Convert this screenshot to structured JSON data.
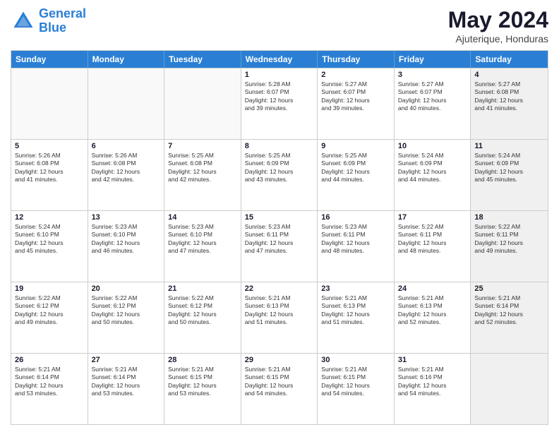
{
  "logo": {
    "line1": "General",
    "line2": "Blue"
  },
  "title": "May 2024",
  "subtitle": "Ajuterique, Honduras",
  "headers": [
    "Sunday",
    "Monday",
    "Tuesday",
    "Wednesday",
    "Thursday",
    "Friday",
    "Saturday"
  ],
  "rows": [
    [
      {
        "day": "",
        "info": "",
        "empty": true
      },
      {
        "day": "",
        "info": "",
        "empty": true
      },
      {
        "day": "",
        "info": "",
        "empty": true
      },
      {
        "day": "1",
        "info": "Sunrise: 5:28 AM\nSunset: 6:07 PM\nDaylight: 12 hours\nand 39 minutes.",
        "empty": false
      },
      {
        "day": "2",
        "info": "Sunrise: 5:27 AM\nSunset: 6:07 PM\nDaylight: 12 hours\nand 39 minutes.",
        "empty": false
      },
      {
        "day": "3",
        "info": "Sunrise: 5:27 AM\nSunset: 6:07 PM\nDaylight: 12 hours\nand 40 minutes.",
        "empty": false
      },
      {
        "day": "4",
        "info": "Sunrise: 5:27 AM\nSunset: 6:08 PM\nDaylight: 12 hours\nand 41 minutes.",
        "empty": false,
        "shaded": true
      }
    ],
    [
      {
        "day": "5",
        "info": "Sunrise: 5:26 AM\nSunset: 6:08 PM\nDaylight: 12 hours\nand 41 minutes.",
        "empty": false
      },
      {
        "day": "6",
        "info": "Sunrise: 5:26 AM\nSunset: 6:08 PM\nDaylight: 12 hours\nand 42 minutes.",
        "empty": false
      },
      {
        "day": "7",
        "info": "Sunrise: 5:25 AM\nSunset: 6:08 PM\nDaylight: 12 hours\nand 42 minutes.",
        "empty": false
      },
      {
        "day": "8",
        "info": "Sunrise: 5:25 AM\nSunset: 6:09 PM\nDaylight: 12 hours\nand 43 minutes.",
        "empty": false
      },
      {
        "day": "9",
        "info": "Sunrise: 5:25 AM\nSunset: 6:09 PM\nDaylight: 12 hours\nand 44 minutes.",
        "empty": false
      },
      {
        "day": "10",
        "info": "Sunrise: 5:24 AM\nSunset: 6:09 PM\nDaylight: 12 hours\nand 44 minutes.",
        "empty": false
      },
      {
        "day": "11",
        "info": "Sunrise: 5:24 AM\nSunset: 6:09 PM\nDaylight: 12 hours\nand 45 minutes.",
        "empty": false,
        "shaded": true
      }
    ],
    [
      {
        "day": "12",
        "info": "Sunrise: 5:24 AM\nSunset: 6:10 PM\nDaylight: 12 hours\nand 45 minutes.",
        "empty": false
      },
      {
        "day": "13",
        "info": "Sunrise: 5:23 AM\nSunset: 6:10 PM\nDaylight: 12 hours\nand 46 minutes.",
        "empty": false
      },
      {
        "day": "14",
        "info": "Sunrise: 5:23 AM\nSunset: 6:10 PM\nDaylight: 12 hours\nand 47 minutes.",
        "empty": false
      },
      {
        "day": "15",
        "info": "Sunrise: 5:23 AM\nSunset: 6:11 PM\nDaylight: 12 hours\nand 47 minutes.",
        "empty": false
      },
      {
        "day": "16",
        "info": "Sunrise: 5:23 AM\nSunset: 6:11 PM\nDaylight: 12 hours\nand 48 minutes.",
        "empty": false
      },
      {
        "day": "17",
        "info": "Sunrise: 5:22 AM\nSunset: 6:11 PM\nDaylight: 12 hours\nand 48 minutes.",
        "empty": false
      },
      {
        "day": "18",
        "info": "Sunrise: 5:22 AM\nSunset: 6:11 PM\nDaylight: 12 hours\nand 49 minutes.",
        "empty": false,
        "shaded": true
      }
    ],
    [
      {
        "day": "19",
        "info": "Sunrise: 5:22 AM\nSunset: 6:12 PM\nDaylight: 12 hours\nand 49 minutes.",
        "empty": false
      },
      {
        "day": "20",
        "info": "Sunrise: 5:22 AM\nSunset: 6:12 PM\nDaylight: 12 hours\nand 50 minutes.",
        "empty": false
      },
      {
        "day": "21",
        "info": "Sunrise: 5:22 AM\nSunset: 6:12 PM\nDaylight: 12 hours\nand 50 minutes.",
        "empty": false
      },
      {
        "day": "22",
        "info": "Sunrise: 5:21 AM\nSunset: 6:13 PM\nDaylight: 12 hours\nand 51 minutes.",
        "empty": false
      },
      {
        "day": "23",
        "info": "Sunrise: 5:21 AM\nSunset: 6:13 PM\nDaylight: 12 hours\nand 51 minutes.",
        "empty": false
      },
      {
        "day": "24",
        "info": "Sunrise: 5:21 AM\nSunset: 6:13 PM\nDaylight: 12 hours\nand 52 minutes.",
        "empty": false
      },
      {
        "day": "25",
        "info": "Sunrise: 5:21 AM\nSunset: 6:14 PM\nDaylight: 12 hours\nand 52 minutes.",
        "empty": false,
        "shaded": true
      }
    ],
    [
      {
        "day": "26",
        "info": "Sunrise: 5:21 AM\nSunset: 6:14 PM\nDaylight: 12 hours\nand 53 minutes.",
        "empty": false
      },
      {
        "day": "27",
        "info": "Sunrise: 5:21 AM\nSunset: 6:14 PM\nDaylight: 12 hours\nand 53 minutes.",
        "empty": false
      },
      {
        "day": "28",
        "info": "Sunrise: 5:21 AM\nSunset: 6:15 PM\nDaylight: 12 hours\nand 53 minutes.",
        "empty": false
      },
      {
        "day": "29",
        "info": "Sunrise: 5:21 AM\nSunset: 6:15 PM\nDaylight: 12 hours\nand 54 minutes.",
        "empty": false
      },
      {
        "day": "30",
        "info": "Sunrise: 5:21 AM\nSunset: 6:15 PM\nDaylight: 12 hours\nand 54 minutes.",
        "empty": false
      },
      {
        "day": "31",
        "info": "Sunrise: 5:21 AM\nSunset: 6:16 PM\nDaylight: 12 hours\nand 54 minutes.",
        "empty": false
      },
      {
        "day": "",
        "info": "",
        "empty": true,
        "shaded": true
      }
    ]
  ]
}
